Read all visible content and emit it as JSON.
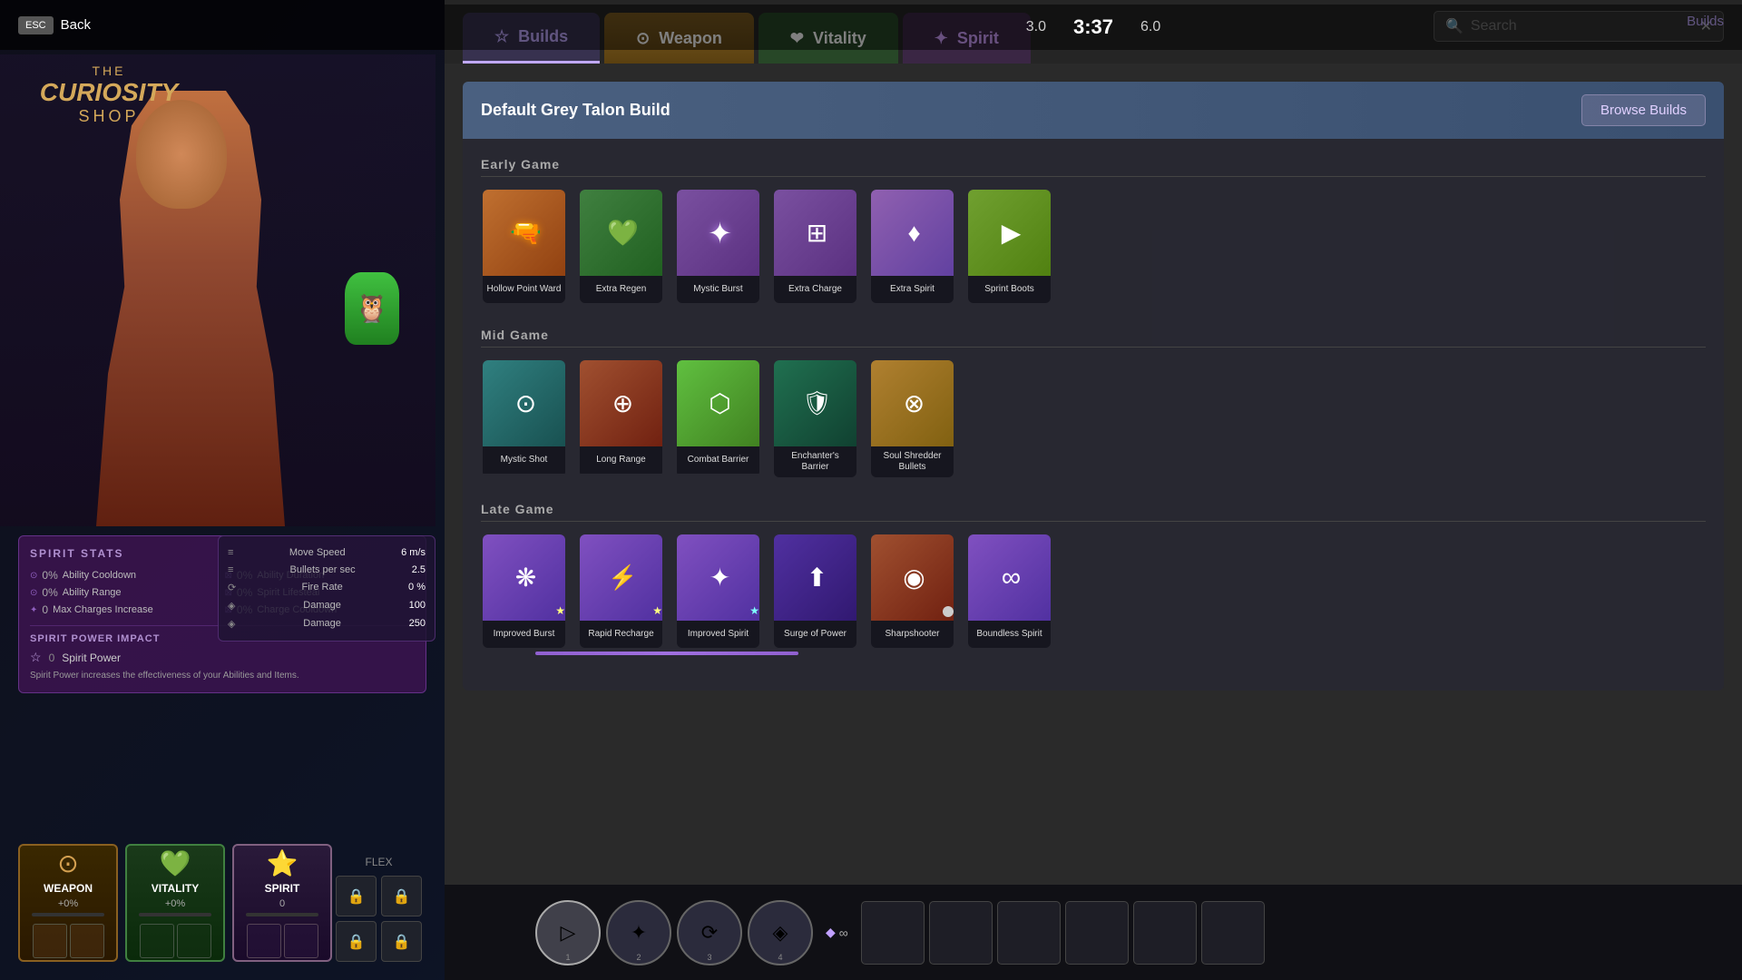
{
  "app": {
    "title": "The Curiosity Shop",
    "the": "THE",
    "curiosity": "CURIOSITY",
    "shop": "SHOP"
  },
  "topbar": {
    "esc_label": "ESC",
    "back_label": "Back",
    "timer": "3:37",
    "score_left": "3.0",
    "score_right": "6.0"
  },
  "nav": {
    "builds_tab": "Builds",
    "weapon_tab": "Weapon",
    "vitality_tab": "Vitality",
    "spirit_tab": "Spirit",
    "search_placeholder": "Search",
    "browse_builds": "Browse Builds"
  },
  "build": {
    "title": "Default Grey Talon Build",
    "browse_builds_label": "Browse Builds",
    "phases": [
      {
        "name": "Early Game",
        "items": [
          {
            "name": "Hollow Point Ward",
            "color": "orange",
            "icon": "🔫"
          },
          {
            "name": "Extra Regen",
            "color": "green",
            "icon": "💚"
          },
          {
            "name": "Mystic Burst",
            "color": "purple",
            "icon": "✦"
          },
          {
            "name": "Extra Charge",
            "color": "purple",
            "icon": "⊞"
          },
          {
            "name": "Extra Spirit",
            "color": "light-purple",
            "icon": "♦"
          },
          {
            "name": "Sprint Boots",
            "color": "lime",
            "icon": "▶"
          }
        ]
      },
      {
        "name": "Mid Game",
        "items": [
          {
            "name": "Mystic Shot",
            "color": "teal",
            "icon": "⊙"
          },
          {
            "name": "Long Range",
            "color": "rust",
            "icon": "⊕"
          },
          {
            "name": "Combat Barrier",
            "color": "bright-green",
            "icon": "⬡"
          },
          {
            "name": "Enchanter's Barrier",
            "color": "dark-green",
            "icon": "🛡"
          },
          {
            "name": "Soul Shredder Bullets",
            "color": "gold",
            "icon": "⊗"
          }
        ]
      },
      {
        "name": "Late Game",
        "items": [
          {
            "name": "Improved Burst",
            "color": "medium-purple",
            "icon": "❋"
          },
          {
            "name": "Rapid Recharge",
            "color": "medium-purple",
            "icon": "⚡"
          },
          {
            "name": "Improved Spirit",
            "color": "medium-purple",
            "icon": "✦"
          },
          {
            "name": "Surge of Power",
            "color": "dark-purple",
            "icon": "⬆"
          },
          {
            "name": "Sharpshooter",
            "color": "rust",
            "icon": "◉"
          },
          {
            "name": "Boundless Spirit",
            "color": "medium-purple",
            "icon": "∞"
          }
        ]
      }
    ]
  },
  "spirit_stats": {
    "title": "SPIRIT STATS",
    "stats": [
      {
        "label": "Ability Cooldown",
        "value": "0%",
        "icon": "⊙"
      },
      {
        "label": "Ability Duration",
        "value": "0%",
        "icon": "⊠"
      },
      {
        "label": "Ability Range",
        "value": "0%",
        "icon": "⊙"
      },
      {
        "label": "Spirit Lifesteal",
        "value": "0%",
        "icon": "⊠"
      },
      {
        "label": "Max Charges Increase",
        "value": "0",
        "icon": "✦"
      },
      {
        "label": "Charge Cooldown",
        "value": "0%",
        "icon": "⊠"
      }
    ]
  },
  "spirit_power": {
    "title": "SPIRIT POWER IMPACT",
    "label": "Spirit Power",
    "value": "0",
    "description": "Spirit Power increases the effectiveness of your Abilities and Items."
  },
  "movement_stats": [
    {
      "label": "Move Speed",
      "value": "6 m/s"
    },
    {
      "label": "Bullets per sec",
      "value": "2.5"
    },
    {
      "label": "Fire Rate",
      "value": "0 %"
    },
    {
      "label": "Damage",
      "value": "100"
    },
    {
      "label": "Damage",
      "value": "250"
    }
  ],
  "upgrades": [
    {
      "name": "WEAPON",
      "pct": "+0%",
      "color": "weapon",
      "icon": "⊙"
    },
    {
      "name": "VITALITY",
      "pct": "+0%",
      "color": "vitality",
      "icon": "💚"
    },
    {
      "name": "SPIRIT",
      "pct": "0",
      "color": "spirit",
      "icon": "⭐"
    }
  ],
  "flex": {
    "label": "FLEX"
  },
  "abilities": [
    {
      "slot": 1,
      "active": true
    },
    {
      "slot": 2,
      "active": false
    },
    {
      "slot": 3,
      "active": false
    },
    {
      "slot": 4,
      "active": false
    }
  ]
}
